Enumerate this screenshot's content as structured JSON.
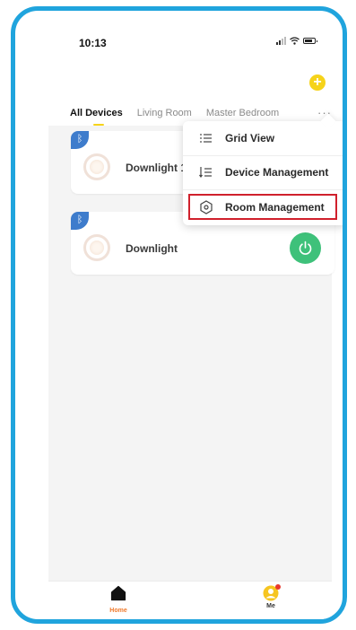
{
  "status_bar": {
    "time": "10:13"
  },
  "header": {
    "tabs": [
      "All Devices",
      "Living Room",
      "Master Bedroom"
    ],
    "more_label": "···"
  },
  "devices": [
    {
      "name": "Downlight 1",
      "connection": "bluetooth",
      "power": "unknown"
    },
    {
      "name": "Downlight",
      "connection": "bluetooth",
      "power": "on"
    }
  ],
  "menu": {
    "items": [
      {
        "label": "Grid View",
        "icon": "list-icon"
      },
      {
        "label": "Device Management",
        "icon": "sort-list-icon"
      },
      {
        "label": "Room Management",
        "icon": "hexagon-settings-icon"
      }
    ],
    "highlighted_item": "Room Management"
  },
  "tabbar": {
    "items": [
      {
        "label": "Home",
        "icon": "home-icon"
      },
      {
        "label": "Me",
        "icon": "profile-icon"
      }
    ]
  },
  "colors": {
    "frame": "#20a4dd",
    "accent_yellow": "#f6d31a",
    "power_green": "#3ec17a",
    "highlight_red": "#d0202c",
    "bluetooth_blue": "#3e7ccc",
    "home_active": "#f07a2c"
  }
}
